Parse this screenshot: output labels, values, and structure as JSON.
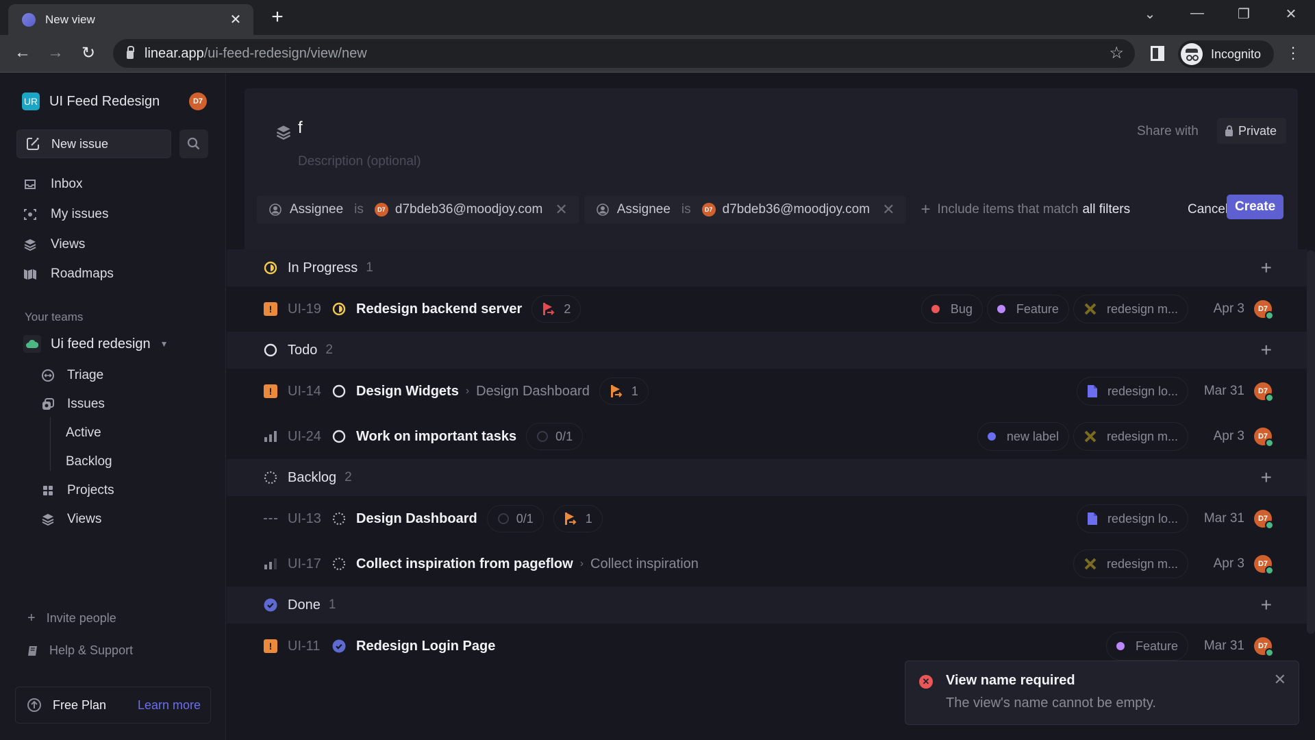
{
  "browser": {
    "tab_title": "New view",
    "url_host": "linear.app",
    "url_path": "/ui-feed-redesign/view/new",
    "profile_label": "Incognito"
  },
  "sidebar": {
    "workspace_initials": "UR",
    "workspace_name": "UI Feed Redesign",
    "user_initials": "D7",
    "new_issue_label": "New issue",
    "nav": [
      {
        "label": "Inbox",
        "icon": "inbox-icon"
      },
      {
        "label": "My issues",
        "icon": "my-issues-icon"
      },
      {
        "label": "Views",
        "icon": "views-icon"
      },
      {
        "label": "Roadmaps",
        "icon": "roadmap-icon"
      }
    ],
    "teams_label": "Your teams",
    "team_name": "Ui feed redesign",
    "team_nav": [
      {
        "label": "Triage",
        "icon": "triage-icon"
      },
      {
        "label": "Issues",
        "icon": "issues-icon"
      },
      {
        "label": "Active",
        "icon": ""
      },
      {
        "label": "Backlog",
        "icon": ""
      },
      {
        "label": "Projects",
        "icon": "projects-icon"
      },
      {
        "label": "Views",
        "icon": "views-icon"
      }
    ],
    "invite_label": "Invite people",
    "help_label": "Help & Support",
    "plan_label": "Free Plan",
    "plan_link": "Learn more"
  },
  "composer": {
    "title_value": "f",
    "description_placeholder": "Description (optional)",
    "share_label": "Share with",
    "privacy_label": "Private",
    "filters": [
      {
        "field": "Assignee",
        "operator": "is",
        "value": "d7bdeb36@moodjoy.com",
        "avatar": "D7"
      },
      {
        "field": "Assignee",
        "operator": "is",
        "value": "d7bdeb36@moodjoy.com",
        "avatar": "D7"
      }
    ],
    "match_prefix": "Include items that match",
    "match_mode": "all filters",
    "cancel_label": "Cancel",
    "create_label": "Create"
  },
  "groups": [
    {
      "name": "In Progress",
      "count": "1",
      "status": "in-progress",
      "issues": [
        {
          "id": "UI-19",
          "priority": "urgent",
          "status": "in-progress",
          "title": "Redesign backend server",
          "parent": "",
          "inline": [
            {
              "type": "sub-issues",
              "text": "2",
              "color": "#e5484d"
            }
          ],
          "labels": [
            {
              "text": "Bug",
              "dot": "#eb5757"
            },
            {
              "text": "Feature",
              "dot": "#bb87fc"
            },
            {
              "text": "redesign m...",
              "icon": "project-tools-icon"
            }
          ],
          "date": "Apr 3",
          "assignee": "D7"
        }
      ]
    },
    {
      "name": "Todo",
      "count": "2",
      "status": "todo",
      "issues": [
        {
          "id": "UI-14",
          "priority": "urgent",
          "status": "todo",
          "title": "Design Widgets",
          "parent": "Design Dashboard",
          "inline": [
            {
              "type": "sub-issues",
              "text": "1",
              "color": "#eb8a3b"
            }
          ],
          "labels": [
            {
              "text": "redesign lo...",
              "icon": "project-doc-icon"
            }
          ],
          "date": "Mar 31",
          "assignee": "D7"
        },
        {
          "id": "UI-24",
          "priority": "high",
          "status": "todo",
          "title": "Work on important tasks",
          "parent": "",
          "inline": [
            {
              "type": "progress",
              "text": "0/1"
            }
          ],
          "labels": [
            {
              "text": "new label",
              "dot": "#6c6ef0"
            },
            {
              "text": "redesign m...",
              "icon": "project-tools-icon"
            }
          ],
          "date": "Apr 3",
          "assignee": "D7"
        }
      ]
    },
    {
      "name": "Backlog",
      "count": "2",
      "status": "backlog",
      "issues": [
        {
          "id": "UI-13",
          "priority": "none",
          "status": "backlog",
          "title": "Design Dashboard",
          "parent": "",
          "inline": [
            {
              "type": "progress",
              "text": "0/1"
            },
            {
              "type": "sub-issues",
              "text": "1",
              "color": "#eb8a3b"
            }
          ],
          "labels": [
            {
              "text": "redesign lo...",
              "icon": "project-doc-icon"
            }
          ],
          "date": "Mar 31",
          "assignee": "D7"
        },
        {
          "id": "UI-17",
          "priority": "medium",
          "status": "backlog",
          "title": "Collect inspiration from pageflow",
          "parent": "Collect inspiration",
          "inline": [],
          "labels": [
            {
              "text": "redesign m...",
              "icon": "project-tools-icon"
            }
          ],
          "date": "Apr 3",
          "assignee": "D7"
        }
      ]
    },
    {
      "name": "Done",
      "count": "1",
      "status": "done",
      "issues": [
        {
          "id": "UI-11",
          "priority": "urgent",
          "status": "done",
          "title": "Redesign Login Page",
          "parent": "",
          "inline": [],
          "labels": [
            {
              "text": "Feature",
              "dot": "#bb87fc"
            }
          ],
          "date": "Mar 31",
          "assignee": "D7"
        }
      ]
    }
  ],
  "toast": {
    "title": "View name required",
    "message": "The view's name cannot be empty."
  },
  "colors": {
    "accent": "#5e5fd0",
    "in_progress": "#f2c94c",
    "done": "#5e6ad2",
    "urgent": "#eb8a3b",
    "error": "#eb5757"
  }
}
